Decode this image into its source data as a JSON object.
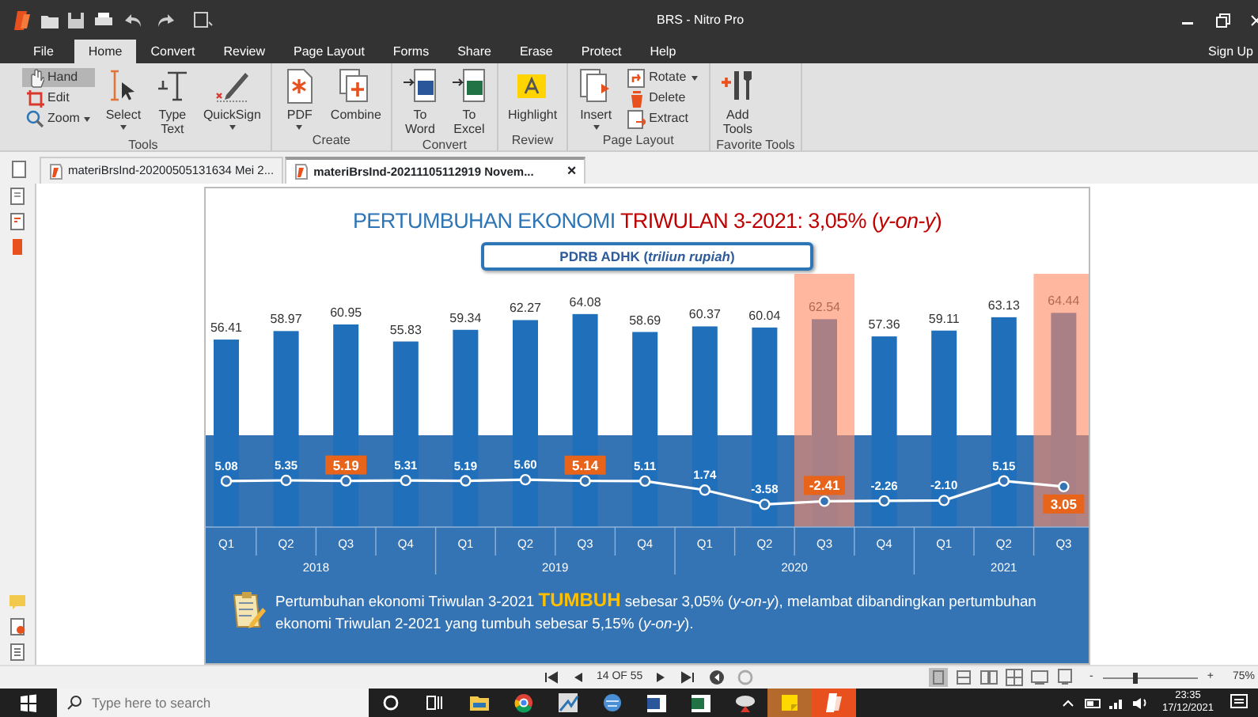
{
  "window": {
    "title": "BRS - Nitro Pro"
  },
  "menu_tabs": [
    {
      "label": "File",
      "selected": false
    },
    {
      "label": "Home",
      "selected": true
    },
    {
      "label": "Convert",
      "selected": false
    },
    {
      "label": "Review",
      "selected": false
    },
    {
      "label": "Page Layout",
      "selected": false
    },
    {
      "label": "Forms",
      "selected": false
    },
    {
      "label": "Share",
      "selected": false
    },
    {
      "label": "Erase",
      "selected": false
    },
    {
      "label": "Protect",
      "selected": false
    },
    {
      "label": "Help",
      "selected": false
    }
  ],
  "sign_up": "Sign Up",
  "ribbon": {
    "groups": [
      {
        "label": "Tools",
        "buttons": [
          {
            "label": "Hand",
            "kind": "small",
            "selected": true,
            "dropdown": false
          },
          {
            "label": "Edit",
            "kind": "small",
            "selected": false,
            "dropdown": false
          },
          {
            "label": "Zoom",
            "kind": "small",
            "selected": false,
            "dropdown": true
          },
          {
            "label": "Select",
            "kind": "large",
            "selected": false,
            "dropdown": true
          },
          {
            "label": "Type Text",
            "kind": "large",
            "selected": false,
            "dropdown": false
          },
          {
            "label": "QuickSign",
            "kind": "large",
            "selected": false,
            "dropdown": true
          }
        ]
      },
      {
        "label": "Create",
        "buttons": [
          {
            "label": "PDF",
            "kind": "large",
            "selected": false,
            "dropdown": true
          },
          {
            "label": "Combine",
            "kind": "large",
            "selected": false,
            "dropdown": false
          }
        ]
      },
      {
        "label": "Convert",
        "buttons": [
          {
            "label": "To Word",
            "kind": "large",
            "selected": false,
            "dropdown": false
          },
          {
            "label": "To Excel",
            "kind": "large",
            "selected": false,
            "dropdown": false
          }
        ]
      },
      {
        "label": "Review",
        "buttons": [
          {
            "label": "Highlight",
            "kind": "large",
            "selected": false,
            "dropdown": false
          }
        ]
      },
      {
        "label": "Page Layout",
        "buttons": [
          {
            "label": "Insert",
            "kind": "large",
            "selected": false,
            "dropdown": true
          },
          {
            "label": "Rotate",
            "kind": "small",
            "selected": false,
            "dropdown": true
          },
          {
            "label": "Delete",
            "kind": "small",
            "selected": false,
            "dropdown": false
          },
          {
            "label": "Extract",
            "kind": "small",
            "selected": false,
            "dropdown": false
          }
        ]
      },
      {
        "label": "Favorite Tools",
        "buttons": [
          {
            "label": "Add Tools",
            "kind": "large",
            "selected": false,
            "dropdown": false
          }
        ]
      }
    ]
  },
  "document_tabs": [
    {
      "label": "materiBrsInd-20200505131634 Mei 2...",
      "selected": false
    },
    {
      "label": "materiBrsInd-20211105112919 Novem...",
      "selected": true,
      "close": "×"
    }
  ],
  "slide": {
    "title": "PERTUMBUHAN EKONOMI **TRIWULAN 3-2021: 3,05% (*y-on-y*)**",
    "subtitle": "PDRB ADHK (*triliun rupiah*)",
    "pdrb_chart": {
      "chart_data": {
        "type": "bar",
        "series": [
          {
            "color": "#1f6fba",
            "values": [
              56.41,
              58.97,
              60.95,
              55.83,
              59.34,
              62.27,
              64.08,
              58.69,
              60.37,
              60.04,
              62.54,
              57.36,
              59.11,
              63.13,
              64.44
            ]
          }
        ],
        "data_labels": true
      }
    },
    "growth_chart": {
      "chart_data": {
        "type": "line",
        "categories": [
          "Q1",
          "Q2",
          "Q3",
          "Q4",
          "Q1",
          "Q2",
          "Q3",
          "Q4",
          "Q1",
          "Q2",
          "Q3",
          "Q4",
          "Q1",
          "Q2",
          "Q3"
        ],
        "series": [
          {
            "color": "#ffffff",
            "marker": true,
            "values": [
              5.08,
              5.35,
              5.19,
              5.31,
              5.19,
              5.6,
              5.14,
              5.11,
              1.74,
              -3.58,
              -2.41,
              -2.26,
              -2.1,
              5.15,
              3.05
            ],
            "value_labels": [
              "5.08",
              "5.35",
              "5.19",
              "5.31",
              "5.19",
              "5.60",
              "5.14",
              "5.11",
              "1.74",
              "-3.58",
              "-2.41",
              "-2.26",
              "-2.10",
              "5.15",
              "3.05"
            ]
          }
        ],
        "data_labels": true
      }
    },
    "quarter_marks": [
      {
        "column_highlight": false,
        "label_highlight": false
      },
      {
        "column_highlight": false,
        "label_highlight": false
      },
      {
        "column_highlight": false,
        "label_highlight": true
      },
      {
        "column_highlight": false,
        "label_highlight": false
      },
      {
        "column_highlight": false,
        "label_highlight": false
      },
      {
        "column_highlight": false,
        "label_highlight": false
      },
      {
        "column_highlight": false,
        "label_highlight": true
      },
      {
        "column_highlight": false,
        "label_highlight": false
      },
      {
        "column_highlight": false,
        "label_highlight": false
      },
      {
        "column_highlight": false,
        "label_highlight": false
      },
      {
        "column_highlight": true,
        "label_highlight": true
      },
      {
        "column_highlight": false,
        "label_highlight": false
      },
      {
        "column_highlight": false,
        "label_highlight": false
      },
      {
        "column_highlight": false,
        "label_highlight": false
      },
      {
        "column_highlight": true,
        "label_highlight": true
      }
    ],
    "years": [
      "2018",
      "2019",
      "2020",
      "2021"
    ],
    "note": "Pertumbuhan ekonomi Triwulan 3-2021 **TUMBUH** sebesar 3,05%  (*y-on-y*), melambat dibandingkan pertumbuhan ekonomi Triwulan 2-2021 yang tumbuh sebesar 5,15% (*y-on-y*)."
  },
  "status_bar": {
    "page_indicator": "14 OF 55",
    "view_modes": [
      {
        "selected": true
      },
      {
        "selected": false
      },
      {
        "selected": false
      },
      {
        "selected": false
      },
      {
        "selected": false
      },
      {
        "selected": false
      }
    ],
    "zoom_minus": "-",
    "zoom_slider": {
      "level": 0.33
    },
    "zoom_plus": "+",
    "zoom": "75%"
  },
  "taskbar": {
    "search": {
      "placeholder": "Type here to search"
    },
    "time": "23:35",
    "date": "17/12/2021"
  }
}
